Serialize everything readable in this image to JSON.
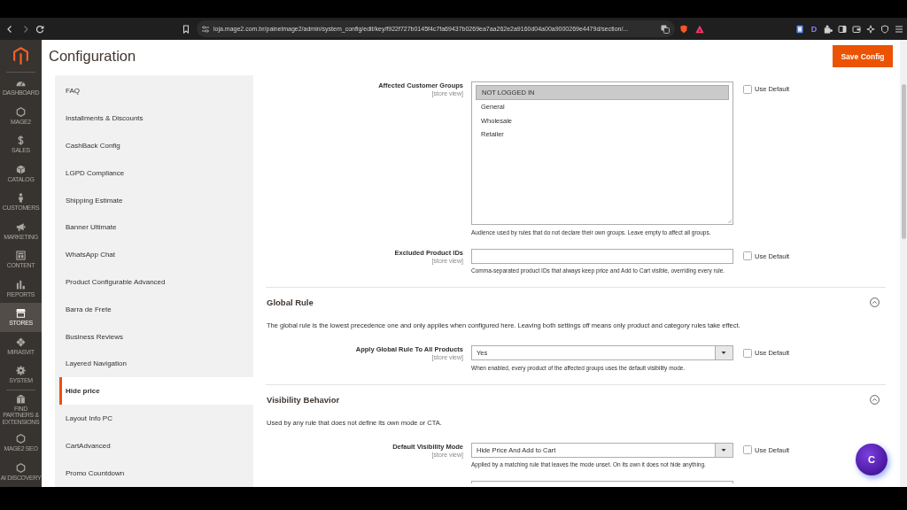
{
  "browser": {
    "url": "loja.mage2.com.br/painelmage2/admin/system_config/edit/key/f922f727b0145f4c7fa69437b0269ea7aa262e2a9160d04a00a9000269e4479d/section/...",
    "extension_badge": "D"
  },
  "admin_nav": {
    "main_items": [
      {
        "label": "DASHBOARD",
        "selected": false
      },
      {
        "label": "MAGE2",
        "selected": false
      },
      {
        "label": "SALES",
        "selected": false
      },
      {
        "label": "CATALOG",
        "selected": false
      },
      {
        "label": "CUSTOMERS",
        "selected": false
      },
      {
        "label": "MARKETING",
        "selected": false
      },
      {
        "label": "CONTENT",
        "selected": false
      },
      {
        "label": "REPORTS",
        "selected": false
      },
      {
        "label": "STORES",
        "selected": true
      },
      {
        "label": "MIRASVIT",
        "selected": false
      },
      {
        "label": "SYSTEM",
        "selected": false
      }
    ],
    "extra_items": [
      {
        "label": "FIND PARTNERS & EXTENSIONS",
        "selected": false
      },
      {
        "label": "MAGE2 SEO",
        "selected": false
      },
      {
        "label": "AI DISCOVERY",
        "selected": false
      }
    ]
  },
  "header": {
    "title": "Configuration",
    "save_button": "Save Config"
  },
  "config_sidebar": {
    "items": [
      {
        "label": "FAQ",
        "selected": false
      },
      {
        "label": "Installments & Discounts",
        "selected": false
      },
      {
        "label": "CashBack Config",
        "selected": false
      },
      {
        "label": "LGPD Compliance",
        "selected": false
      },
      {
        "label": "Shipping Estimate",
        "selected": false
      },
      {
        "label": "Banner Ultimate",
        "selected": false
      },
      {
        "label": "WhatsApp Chat",
        "selected": false
      },
      {
        "label": "Product Configurable Advanced",
        "selected": false
      },
      {
        "label": "Barra de Frete",
        "selected": false
      },
      {
        "label": "Business Reviews",
        "selected": false
      },
      {
        "label": "Layered Navigation",
        "selected": false
      },
      {
        "label": "Hide price",
        "selected": true
      },
      {
        "label": "Layout Info PC",
        "selected": false
      },
      {
        "label": "CartAdvanced",
        "selected": false
      },
      {
        "label": "Promo Countdown",
        "selected": false
      }
    ]
  },
  "form": {
    "rows": [
      {
        "kind": "multiselect",
        "label": "Affected Customer Groups",
        "scope": "[store view]",
        "options": [
          {
            "label": "NOT LOGGED IN",
            "selected": true
          },
          {
            "label": "General",
            "selected": false
          },
          {
            "label": "Wholesale",
            "selected": false
          },
          {
            "label": "Retailer",
            "selected": false
          }
        ],
        "use_default": {
          "label": "Use Default",
          "checked": false
        },
        "note": "Audience used by rules that do not declare their own groups. Leave empty to affect all groups."
      },
      {
        "kind": "text",
        "label": "Excluded Product IDs",
        "scope": "[store view]",
        "use_default": {
          "label": "Use Default",
          "checked": false
        },
        "note": "Comma-separated product IDs that always keep price and Add to Cart visible, overriding every rule."
      }
    ],
    "sections": [
      {
        "title": "Global Rule",
        "expanded": true,
        "description": "The global rule is the lowest precedence one and only applies when configured here. Leaving both settings off means only product and category rules take effect.",
        "rows": [
          {
            "kind": "select",
            "label": "Apply Global Rule To All Products",
            "scope": "[store view]",
            "value": "Yes",
            "use_default": {
              "label": "Use Default",
              "checked": false
            },
            "note": "When enabled, every product of the affected groups uses the default visibility mode."
          }
        ]
      },
      {
        "title": "Visibility Behavior",
        "expanded": true,
        "description": "Used by any rule that does not define its own mode or CTA.",
        "rows": [
          {
            "kind": "select",
            "label": "Default Visibility Mode",
            "scope": "[store view]",
            "value": "Hide Price And Add to Cart",
            "use_default": {
              "label": "Use Default",
              "checked": false
            },
            "note": "Applied by a matching rule that leaves the mode unset. On its own it does not hide anything."
          },
          {
            "kind": "select"
          }
        ]
      }
    ]
  },
  "chat_button": {
    "label": "C"
  }
}
